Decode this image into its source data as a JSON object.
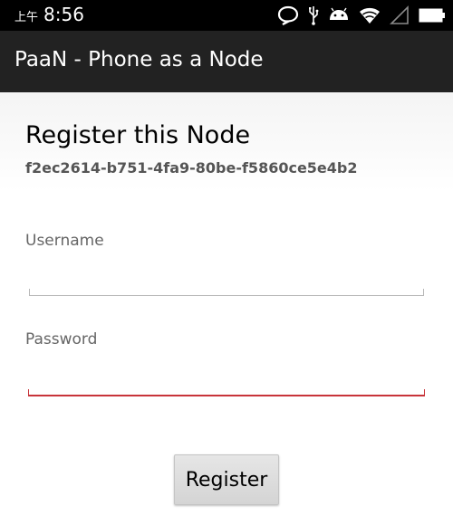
{
  "status_bar": {
    "time_prefix": "上午",
    "time": "8:56",
    "icons": [
      "chat-bubble-icon",
      "usb-icon",
      "android-icon",
      "wifi-icon",
      "no-signal-icon",
      "battery-icon"
    ]
  },
  "action_bar": {
    "title": "PaaN - Phone as a Node"
  },
  "form": {
    "title": "Register this Node",
    "node_id": "f2ec2614-b751-4fa9-80be-f5860ce5e4b2",
    "username_label": "Username",
    "username_value": "",
    "password_label": "Password",
    "password_value": "",
    "register_label": "Register"
  },
  "colors": {
    "status_bar_bg": "#000000",
    "action_bar_bg": "#222222",
    "focus_underline": "#c8343a"
  }
}
